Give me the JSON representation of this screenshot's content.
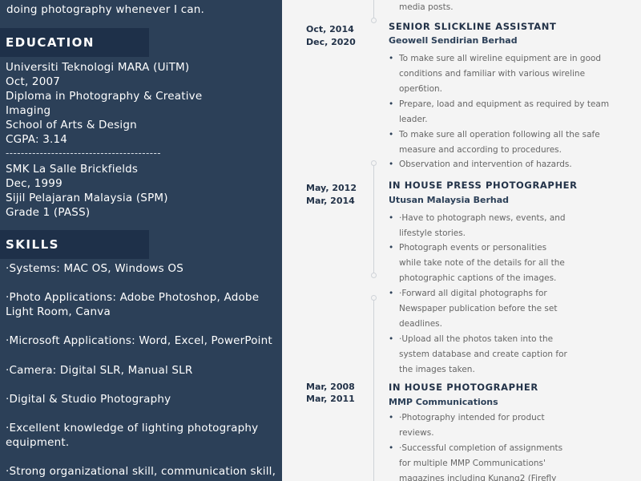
{
  "sidebar": {
    "intro_tail": "doing photography whenever I can.",
    "education": {
      "heading": "EDUCATION",
      "lines": [
        "Universiti Teknologi MARA (UiTM)",
        "Oct, 2007",
        "Diploma in Photography & Creative",
        "Imaging",
        "School of Arts & Design",
        "CGPA: 3.14"
      ],
      "separator": "-----------------------------------------",
      "lines2": [
        "SMK La Salle Brickfields",
        "Dec, 1999",
        "Sijil Pelajaran Malaysia (SPM)",
        "Grade 1 (PASS)"
      ]
    },
    "skills": {
      "heading": "SKILLS",
      "lines": [
        "·Systems: MAC OS, Windows OS",
        "·Photo Applications: Adobe Photoshop, Adobe",
        "Light Room, Canva",
        "·Microsoft Applications: Word, Excel, PowerPoint",
        "·Camera: Digital SLR, Manual SLR",
        "·Digital & Studio Photography",
        "·Excellent knowledge of lighting photography",
        "equipment.",
        "·Strong organizational skill, communication skill,"
      ]
    }
  },
  "main": {
    "top_fragment": "media posts.",
    "jobs": [
      {
        "date_start": "Oct, 2014",
        "date_end": "Dec, 2020",
        "title": "SENIOR SLICKLINE ASSISTANT",
        "company": "Geowell Sendirian Berhad",
        "bullets": [
          "To make sure all wireline equipment are in good\nconditions and familiar with various wireline\noper6tion.",
          "Prepare, load and equipment as required by team\nleader.",
          "To make sure all operation following all the safe\nmeasure and according to procedures.",
          "Observation and intervention of hazards."
        ]
      },
      {
        "date_start": "May, 2012",
        "date_end": "Mar, 2014",
        "title": "IN HOUSE PRESS PHOTOGRAPHER",
        "company": "Utusan Malaysia Berhad",
        "bullets": [
          "·Have to photograph news, events, and\nlifestyle stories.",
          "Photograph events or personalities\nwhile take note of the details for all the\nphotographic captions of the images.",
          "·Forward all digital photographs for\nNewspaper publication before the set\ndeadlines.",
          "·Upload all the photos taken into the\nsystem database and create caption for\nthe images taken."
        ]
      },
      {
        "date_start": "Mar, 2008",
        "date_end": "Mar, 2011",
        "title": "IN HOUSE PHOTOGRAPHER",
        "company": "MMP Communications",
        "bullets": [
          "·Photography intended for product\nreviews.",
          "·Successful completion of assignments\nfor multiple MMP Communications'\nmagazines including Kunang2 (Firefly"
        ]
      }
    ],
    "bullet_symbol": "•"
  },
  "colors": {
    "sidebar_bg": "#2c4058",
    "heading_bg": "#1e3049",
    "main_bg": "#f4f4f4",
    "accent": "#223248"
  }
}
